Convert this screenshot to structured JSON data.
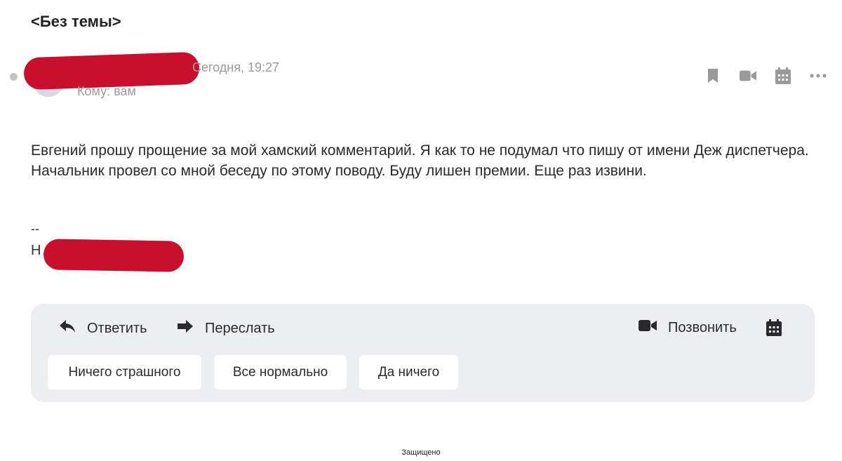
{
  "subject": "<Без темы>",
  "message": {
    "date": "Сегодня, 19:27",
    "to": "Кому: вам",
    "body": "Евгений прошу прощение за мой хамский комментарий. Я как то не подумал что пишу от имени Деж диспетчера. Начальник провел со мной беседу по этому поводу. Буду лишен премии. Еще раз извини.",
    "signature_separator": "--",
    "signature_visible": "Н"
  },
  "top_actions": [
    "bookmark-icon",
    "video-icon",
    "calendar-icon",
    "more-icon"
  ],
  "panel": {
    "reply_label": "Ответить",
    "forward_label": "Переслать",
    "call_label": "Позвонить",
    "quick_replies": [
      "Ничего страшного",
      "Все нормально",
      "Да ничего"
    ]
  },
  "footer": "Защищено",
  "colors": {
    "redaction": "#c8102e",
    "panel_bg": "#eceef0",
    "muted_text": "#9a9a9a",
    "icon": "#333333"
  }
}
